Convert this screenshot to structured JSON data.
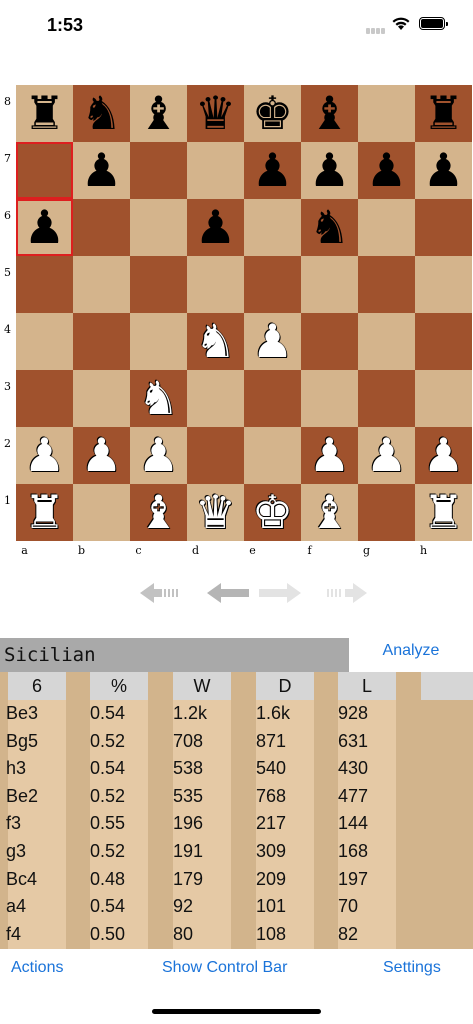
{
  "status": {
    "time": "1:53"
  },
  "board": {
    "rank_labels": [
      "8",
      "7",
      "6",
      "5",
      "4",
      "3",
      "2",
      "1"
    ],
    "file_labels": [
      "a",
      "b",
      "c",
      "d",
      "e",
      "f",
      "g",
      "h"
    ],
    "pieces": [
      "rnbqkb.r",
      ".p..pppp",
      "p..p.n..",
      "........",
      "...NP...",
      "..N.....",
      "PPP..PPP",
      "R.BQKB.R"
    ],
    "highlight": [
      "a7",
      "a6"
    ],
    "colors": {
      "light": "#d4b48c",
      "dark": "#a0522d",
      "highlight": "#dd1f1f"
    }
  },
  "nav_icons": [
    "first-move-icon",
    "previous-move-icon",
    "next-move-icon",
    "last-move-icon"
  ],
  "opening": {
    "name": "Sicilian",
    "analyze_label": "Analyze"
  },
  "stats": {
    "headers": [
      "6",
      "%",
      "W",
      "D",
      "L"
    ],
    "rows": [
      [
        "Be3",
        "0.54",
        "1.2k",
        "1.6k",
        "928"
      ],
      [
        "Bg5",
        "0.52",
        "708",
        "871",
        "631"
      ],
      [
        "h3",
        "0.54",
        "538",
        "540",
        "430"
      ],
      [
        "Be2",
        "0.52",
        "535",
        "768",
        "477"
      ],
      [
        "f3",
        "0.55",
        "196",
        "217",
        "144"
      ],
      [
        "g3",
        "0.52",
        "191",
        "309",
        "168"
      ],
      [
        "Bc4",
        "0.48",
        "179",
        "209",
        "197"
      ],
      [
        "a4",
        "0.54",
        "92",
        "101",
        "70"
      ],
      [
        "f4",
        "0.50",
        "80",
        "108",
        "82"
      ]
    ]
  },
  "bottom": {
    "actions": "Actions",
    "control_bar": "Show Control Bar",
    "settings": "Settings"
  },
  "accent": "#1a73d9"
}
